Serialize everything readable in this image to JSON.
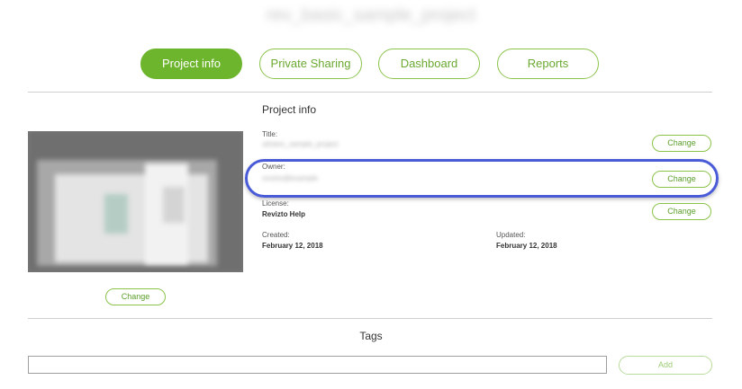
{
  "header": {
    "project_name": "rev_basic_sample_project"
  },
  "tabs": [
    {
      "label": "Project info",
      "active": true
    },
    {
      "label": "Private Sharing",
      "active": false
    },
    {
      "label": "Dashboard",
      "active": false
    },
    {
      "label": "Reports",
      "active": false
    }
  ],
  "thumbnail": {
    "change_label": "Change"
  },
  "info": {
    "section_title": "Project info",
    "title_label": "Title:",
    "title_value": "ultrainc_sample_project",
    "title_change": "Change",
    "owner_label": "Owner:",
    "owner_value": "revizto@example",
    "owner_change": "Change",
    "license_label": "License:",
    "license_value": "Revizto Help",
    "license_change": "Change",
    "created_label": "Created:",
    "created_value": "February 12, 2018",
    "updated_label": "Updated:",
    "updated_value": "February 12, 2018"
  },
  "tags": {
    "title": "Tags",
    "input_value": "",
    "input_placeholder": "",
    "add_label": "Add"
  },
  "colors": {
    "accent": "#6cb52d",
    "accent_border": "#8bc34a",
    "highlight": "#4a5bd8"
  }
}
